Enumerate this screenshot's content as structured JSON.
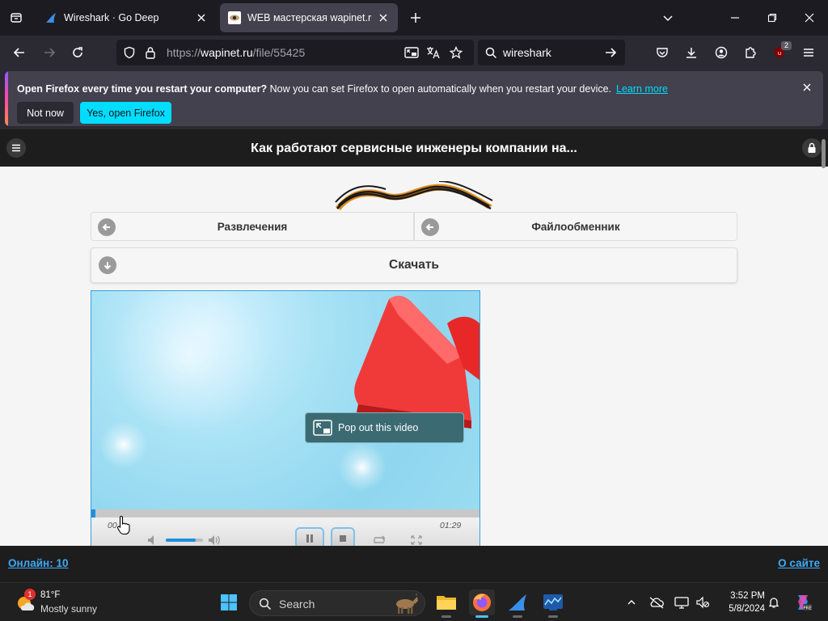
{
  "tabs": [
    {
      "title": "Wireshark · Go Deep"
    },
    {
      "title": "WEB мастерская wapinet.ru - Ф"
    }
  ],
  "navbar": {
    "url_prefix": "https://",
    "url_host": "wapinet.ru",
    "url_path": "/file/55425",
    "search_value": "wireshark",
    "extensions_badge": "2"
  },
  "notification": {
    "bold_text": "Open Firefox every time you restart your computer?",
    "text": " Now you can set Firefox to open automatically when you restart your device.",
    "learn_more": "Learn more",
    "not_now": "Not now",
    "yes_open": "Yes, open Firefox"
  },
  "site": {
    "title": "Как работают сервисные инженеры компании на...",
    "nav_left": "Развлечения",
    "nav_right": "Файлообменник",
    "download": "Скачать",
    "online": "Онлайн: 10",
    "about": "О сайте"
  },
  "player": {
    "popout_label": "Pop out this video",
    "current_time": "00",
    "duration": "01:29",
    "progress_fraction": 0.01,
    "volume_fraction": 0.8
  },
  "taskbar": {
    "temp": "81°F",
    "condition": "Mostly sunny",
    "weather_badge": "1",
    "search_label": "Search",
    "time": "3:52 PM",
    "date": "5/8/2024"
  },
  "colors": {
    "accent_cyan": "#00ddff",
    "link_blue": "#3fa9f5",
    "player_progress": "#1e8fe0"
  }
}
